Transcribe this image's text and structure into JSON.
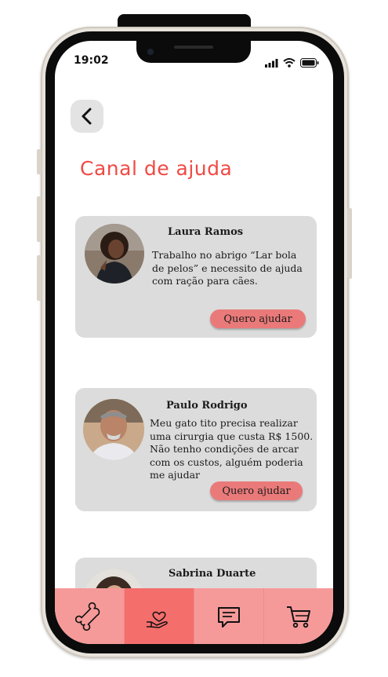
{
  "status_bar": {
    "time": "19:02"
  },
  "header": {
    "title": "Canal de ajuda"
  },
  "posts": [
    {
      "name": "Laura Ramos",
      "text_lines": [
        "Trabalho no abrigo “Lar bola",
        "de pelos” e necessito de ajuda",
        "com ração para cães."
      ],
      "button_label": "Quero ajudar"
    },
    {
      "name": "Paulo Rodrigo",
      "text_lines": [
        "Meu gato tito precisa realizar",
        "uma cirurgia que custa R$ 1500.",
        "Não tenho condições de arcar",
        "com os custos, alguém poderia",
        "me ajudar"
      ],
      "button_label": "Quero ajudar"
    },
    {
      "name": "Sabrina Duarte"
    }
  ],
  "tabbar": {
    "items": [
      {
        "icon": "bone-icon"
      },
      {
        "icon": "heart-hand-icon",
        "active": true
      },
      {
        "icon": "chat-icon"
      },
      {
        "icon": "cart-icon"
      }
    ]
  },
  "colors": {
    "title": "#f04a45",
    "card": "#dcdcdc",
    "button": "#ea7a7a",
    "tab": "#f59a99",
    "tab_active": "#f46e6c"
  }
}
